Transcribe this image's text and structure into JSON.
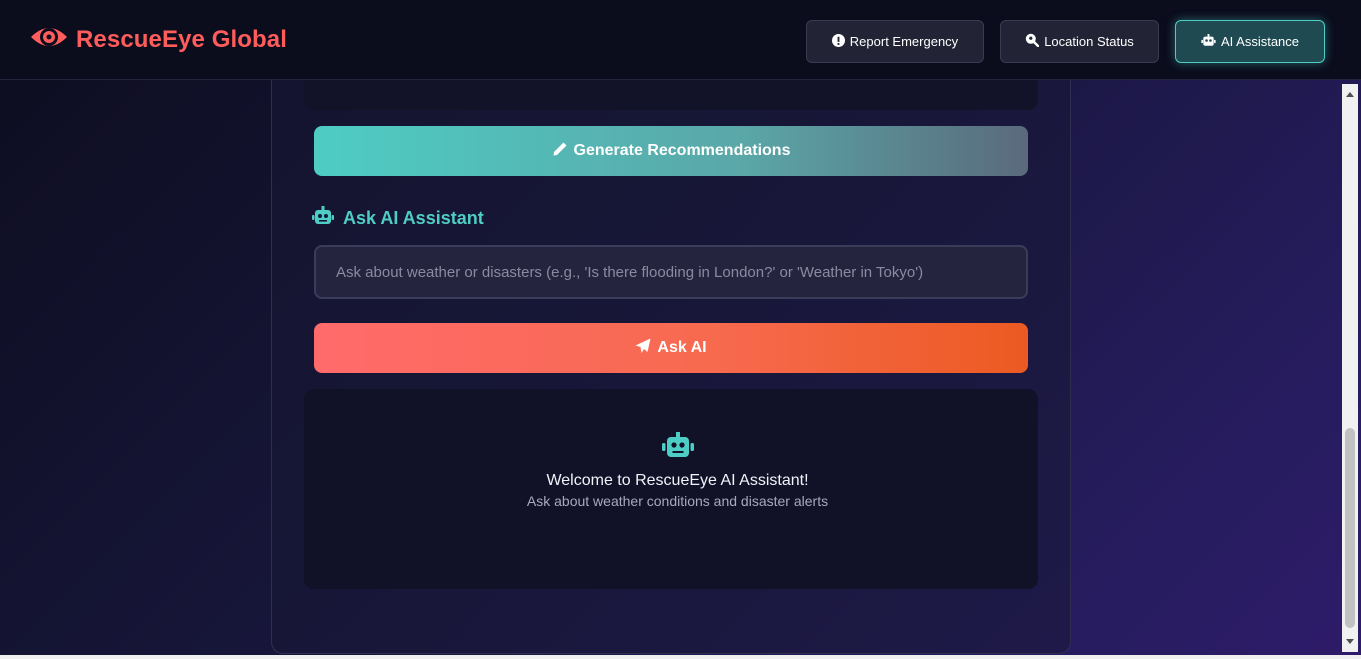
{
  "header": {
    "brand": "RescueEye Global",
    "nav": [
      {
        "label": "Report Emergency",
        "icon": "exclamation-circle-icon"
      },
      {
        "label": "Location Status",
        "icon": "search-location-icon"
      },
      {
        "label": "AI Assistance",
        "icon": "robot-icon",
        "active": true
      }
    ]
  },
  "main": {
    "generate_button": "Generate Recommendations",
    "ask_section_title": "Ask AI Assistant",
    "ask_input_placeholder": "Ask about weather or disasters (e.g., 'Is there flooding in London?' or 'Weather in Tokyo')",
    "ask_button": "Ask AI",
    "welcome_title": "Welcome to RescueEye AI Assistant!",
    "welcome_subtitle": "Ask about weather conditions and disaster alerts"
  },
  "colors": {
    "brand": "#ff5c5c",
    "accent_teal": "#4ecdc4",
    "ask_button_start": "#ff6b6b",
    "ask_button_end": "#ec5a22"
  }
}
